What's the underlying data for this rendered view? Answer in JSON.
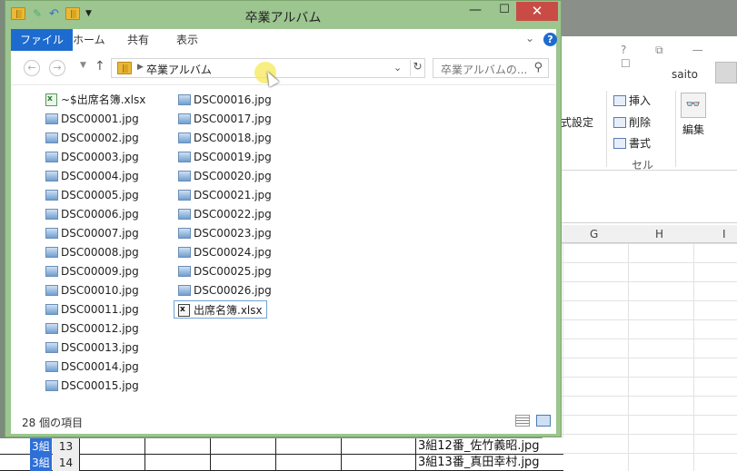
{
  "window": {
    "title": "卒業アルバム",
    "min_glyph": "—",
    "max_glyph": "☐",
    "close_glyph": "✕"
  },
  "ribbon_tabs": [
    {
      "label": "ファイル",
      "active": true
    },
    {
      "label": "ホーム"
    },
    {
      "label": "共有"
    },
    {
      "label": "表示"
    }
  ],
  "address": {
    "crumb": "卒業アルバム"
  },
  "search": {
    "placeholder": "卒業アルバムの..."
  },
  "files_col1": [
    {
      "name": "~$出席名簿.xlsx",
      "type": "excel"
    },
    {
      "name": "DSC00001.jpg",
      "type": "image"
    },
    {
      "name": "DSC00002.jpg",
      "type": "image"
    },
    {
      "name": "DSC00003.jpg",
      "type": "image"
    },
    {
      "name": "DSC00004.jpg",
      "type": "image"
    },
    {
      "name": "DSC00005.jpg",
      "type": "image"
    },
    {
      "name": "DSC00006.jpg",
      "type": "image"
    },
    {
      "name": "DSC00007.jpg",
      "type": "image"
    },
    {
      "name": "DSC00008.jpg",
      "type": "image"
    },
    {
      "name": "DSC00009.jpg",
      "type": "image"
    },
    {
      "name": "DSC00010.jpg",
      "type": "image"
    },
    {
      "name": "DSC00011.jpg",
      "type": "image"
    },
    {
      "name": "DSC00012.jpg",
      "type": "image"
    },
    {
      "name": "DSC00013.jpg",
      "type": "image"
    },
    {
      "name": "DSC00014.jpg",
      "type": "image"
    },
    {
      "name": "DSC00015.jpg",
      "type": "image"
    }
  ],
  "files_col2": [
    {
      "name": "DSC00016.jpg",
      "type": "image"
    },
    {
      "name": "DSC00017.jpg",
      "type": "image"
    },
    {
      "name": "DSC00018.jpg",
      "type": "image"
    },
    {
      "name": "DSC00019.jpg",
      "type": "image"
    },
    {
      "name": "DSC00020.jpg",
      "type": "image"
    },
    {
      "name": "DSC00021.jpg",
      "type": "image"
    },
    {
      "name": "DSC00022.jpg",
      "type": "image"
    },
    {
      "name": "DSC00023.jpg",
      "type": "image"
    },
    {
      "name": "DSC00024.jpg",
      "type": "image"
    },
    {
      "name": "DSC00025.jpg",
      "type": "image"
    },
    {
      "name": "DSC00026.jpg",
      "type": "image"
    },
    {
      "name": "出席名簿.xlsx",
      "type": "excel",
      "selected": true
    }
  ],
  "status": {
    "count": "28 個の項目"
  },
  "excel": {
    "user": "saito",
    "ribbon_insert": "挿入",
    "ribbon_delete": "削除",
    "ribbon_format": "書式",
    "ribbon_cells": "セル",
    "ribbon_edit": "編集",
    "ribbon_settings": "式設定",
    "col_g": "G",
    "col_h": "H",
    "col_i": "I",
    "rows": [
      {
        "tag": "3組",
        "num": "13",
        "text": "3組12番_佐竹義昭.jpg"
      },
      {
        "tag": "3組",
        "num": "14",
        "text": "3組13番_真田幸村.jpg"
      }
    ]
  }
}
